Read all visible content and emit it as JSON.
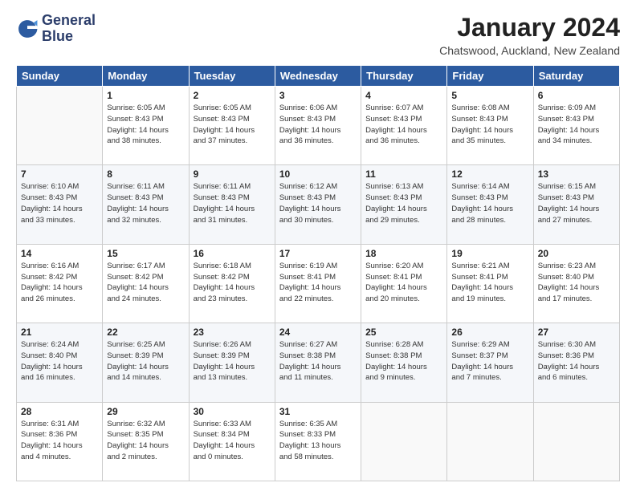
{
  "header": {
    "logo_line1": "General",
    "logo_line2": "Blue",
    "month_title": "January 2024",
    "location": "Chatswood, Auckland, New Zealand"
  },
  "days_of_week": [
    "Sunday",
    "Monday",
    "Tuesday",
    "Wednesday",
    "Thursday",
    "Friday",
    "Saturday"
  ],
  "weeks": [
    [
      {
        "day": "",
        "info": ""
      },
      {
        "day": "1",
        "info": "Sunrise: 6:05 AM\nSunset: 8:43 PM\nDaylight: 14 hours\nand 38 minutes."
      },
      {
        "day": "2",
        "info": "Sunrise: 6:05 AM\nSunset: 8:43 PM\nDaylight: 14 hours\nand 37 minutes."
      },
      {
        "day": "3",
        "info": "Sunrise: 6:06 AM\nSunset: 8:43 PM\nDaylight: 14 hours\nand 36 minutes."
      },
      {
        "day": "4",
        "info": "Sunrise: 6:07 AM\nSunset: 8:43 PM\nDaylight: 14 hours\nand 36 minutes."
      },
      {
        "day": "5",
        "info": "Sunrise: 6:08 AM\nSunset: 8:43 PM\nDaylight: 14 hours\nand 35 minutes."
      },
      {
        "day": "6",
        "info": "Sunrise: 6:09 AM\nSunset: 8:43 PM\nDaylight: 14 hours\nand 34 minutes."
      }
    ],
    [
      {
        "day": "7",
        "info": "Sunrise: 6:10 AM\nSunset: 8:43 PM\nDaylight: 14 hours\nand 33 minutes."
      },
      {
        "day": "8",
        "info": "Sunrise: 6:11 AM\nSunset: 8:43 PM\nDaylight: 14 hours\nand 32 minutes."
      },
      {
        "day": "9",
        "info": "Sunrise: 6:11 AM\nSunset: 8:43 PM\nDaylight: 14 hours\nand 31 minutes."
      },
      {
        "day": "10",
        "info": "Sunrise: 6:12 AM\nSunset: 8:43 PM\nDaylight: 14 hours\nand 30 minutes."
      },
      {
        "day": "11",
        "info": "Sunrise: 6:13 AM\nSunset: 8:43 PM\nDaylight: 14 hours\nand 29 minutes."
      },
      {
        "day": "12",
        "info": "Sunrise: 6:14 AM\nSunset: 8:43 PM\nDaylight: 14 hours\nand 28 minutes."
      },
      {
        "day": "13",
        "info": "Sunrise: 6:15 AM\nSunset: 8:43 PM\nDaylight: 14 hours\nand 27 minutes."
      }
    ],
    [
      {
        "day": "14",
        "info": "Sunrise: 6:16 AM\nSunset: 8:42 PM\nDaylight: 14 hours\nand 26 minutes."
      },
      {
        "day": "15",
        "info": "Sunrise: 6:17 AM\nSunset: 8:42 PM\nDaylight: 14 hours\nand 24 minutes."
      },
      {
        "day": "16",
        "info": "Sunrise: 6:18 AM\nSunset: 8:42 PM\nDaylight: 14 hours\nand 23 minutes."
      },
      {
        "day": "17",
        "info": "Sunrise: 6:19 AM\nSunset: 8:41 PM\nDaylight: 14 hours\nand 22 minutes."
      },
      {
        "day": "18",
        "info": "Sunrise: 6:20 AM\nSunset: 8:41 PM\nDaylight: 14 hours\nand 20 minutes."
      },
      {
        "day": "19",
        "info": "Sunrise: 6:21 AM\nSunset: 8:41 PM\nDaylight: 14 hours\nand 19 minutes."
      },
      {
        "day": "20",
        "info": "Sunrise: 6:23 AM\nSunset: 8:40 PM\nDaylight: 14 hours\nand 17 minutes."
      }
    ],
    [
      {
        "day": "21",
        "info": "Sunrise: 6:24 AM\nSunset: 8:40 PM\nDaylight: 14 hours\nand 16 minutes."
      },
      {
        "day": "22",
        "info": "Sunrise: 6:25 AM\nSunset: 8:39 PM\nDaylight: 14 hours\nand 14 minutes."
      },
      {
        "day": "23",
        "info": "Sunrise: 6:26 AM\nSunset: 8:39 PM\nDaylight: 14 hours\nand 13 minutes."
      },
      {
        "day": "24",
        "info": "Sunrise: 6:27 AM\nSunset: 8:38 PM\nDaylight: 14 hours\nand 11 minutes."
      },
      {
        "day": "25",
        "info": "Sunrise: 6:28 AM\nSunset: 8:38 PM\nDaylight: 14 hours\nand 9 minutes."
      },
      {
        "day": "26",
        "info": "Sunrise: 6:29 AM\nSunset: 8:37 PM\nDaylight: 14 hours\nand 7 minutes."
      },
      {
        "day": "27",
        "info": "Sunrise: 6:30 AM\nSunset: 8:36 PM\nDaylight: 14 hours\nand 6 minutes."
      }
    ],
    [
      {
        "day": "28",
        "info": "Sunrise: 6:31 AM\nSunset: 8:36 PM\nDaylight: 14 hours\nand 4 minutes."
      },
      {
        "day": "29",
        "info": "Sunrise: 6:32 AM\nSunset: 8:35 PM\nDaylight: 14 hours\nand 2 minutes."
      },
      {
        "day": "30",
        "info": "Sunrise: 6:33 AM\nSunset: 8:34 PM\nDaylight: 14 hours\nand 0 minutes."
      },
      {
        "day": "31",
        "info": "Sunrise: 6:35 AM\nSunset: 8:33 PM\nDaylight: 13 hours\nand 58 minutes."
      },
      {
        "day": "",
        "info": ""
      },
      {
        "day": "",
        "info": ""
      },
      {
        "day": "",
        "info": ""
      }
    ]
  ]
}
